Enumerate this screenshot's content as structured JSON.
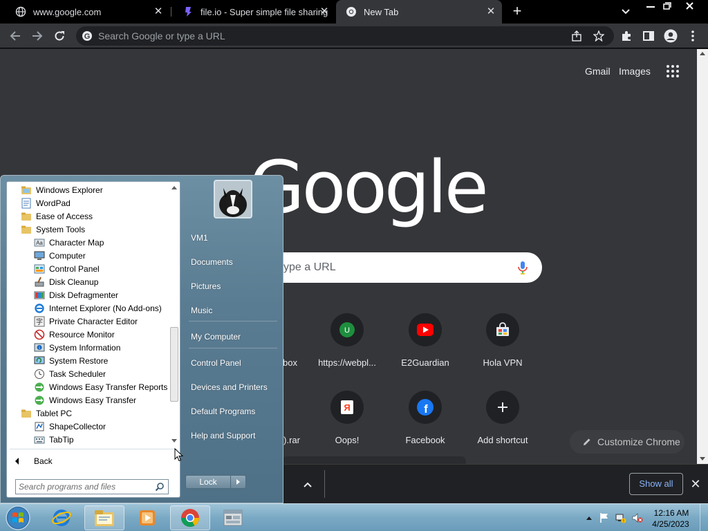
{
  "browser": {
    "tabs": [
      {
        "title": "www.google.com",
        "icon": "globe-icon"
      },
      {
        "title": "file.io - Super simple file sharing",
        "icon": "fileio-icon"
      },
      {
        "title": "New Tab",
        "icon": "chrome-icon"
      }
    ],
    "omnibox_placeholder": "Search Google or type a URL"
  },
  "ntp": {
    "gmail": "Gmail",
    "images": "Images",
    "logo": "Google",
    "search_placeholder": "ype a URL",
    "shortcuts": [
      {
        "label": "box",
        "icon": "hidden-icon"
      },
      {
        "label": "https://webpl...",
        "icon": "letter-u-icon",
        "letter": "U",
        "color": "#1e8e3e"
      },
      {
        "label": "E2Guardian",
        "icon": "youtube-icon",
        "color": "#ff0000"
      },
      {
        "label": "Hola VPN",
        "icon": "store-icon"
      },
      {
        "label": ").rar",
        "icon": "hidden-icon"
      },
      {
        "label": "Oops!",
        "icon": "yandex-icon"
      },
      {
        "label": "Facebook",
        "icon": "facebook-icon",
        "color": "#1877f2"
      },
      {
        "label": "Add shortcut",
        "icon": "plus-icon"
      }
    ],
    "customize": "Customize Chrome"
  },
  "downloads": {
    "show_all": "Show all"
  },
  "start_menu": {
    "programs": [
      {
        "label": "Windows Explorer",
        "icon": "folder-explorer-icon",
        "indent": 1
      },
      {
        "label": "WordPad",
        "icon": "wordpad-icon",
        "indent": 1
      },
      {
        "label": "Ease of Access",
        "icon": "folder-icon",
        "indent": 1
      },
      {
        "label": "System Tools",
        "icon": "folder-icon",
        "indent": 1
      },
      {
        "label": "Character Map",
        "icon": "character-map-icon",
        "indent": 2
      },
      {
        "label": "Computer",
        "icon": "computer-icon",
        "indent": 2
      },
      {
        "label": "Control Panel",
        "icon": "control-panel-icon",
        "indent": 2
      },
      {
        "label": "Disk Cleanup",
        "icon": "disk-cleanup-icon",
        "indent": 2
      },
      {
        "label": "Disk Defragmenter",
        "icon": "defragmenter-icon",
        "indent": 2
      },
      {
        "label": "Internet Explorer (No Add-ons)",
        "icon": "internet-explorer-icon",
        "indent": 2
      },
      {
        "label": "Private Character Editor",
        "icon": "character-editor-icon",
        "indent": 2
      },
      {
        "label": "Resource Monitor",
        "icon": "resource-monitor-icon",
        "indent": 2
      },
      {
        "label": "System Information",
        "icon": "system-information-icon",
        "indent": 2
      },
      {
        "label": "System Restore",
        "icon": "system-restore-icon",
        "indent": 2
      },
      {
        "label": "Task Scheduler",
        "icon": "task-scheduler-icon",
        "indent": 2
      },
      {
        "label": "Windows Easy Transfer Reports",
        "icon": "easy-transfer-icon",
        "indent": 2
      },
      {
        "label": "Windows Easy Transfer",
        "icon": "easy-transfer-icon",
        "indent": 2
      },
      {
        "label": "Tablet PC",
        "icon": "folder-icon",
        "indent": 1
      },
      {
        "label": "ShapeCollector",
        "icon": "shape-collector-icon",
        "indent": 2
      },
      {
        "label": "TabTip",
        "icon": "tabtip-icon",
        "indent": 2
      }
    ],
    "back": "Back",
    "search_placeholder": "Search programs and files",
    "right_links": [
      {
        "label": "VM1"
      },
      {
        "label": "Documents"
      },
      {
        "label": "Pictures"
      },
      {
        "label": "Music"
      },
      {
        "label": "My Computer"
      },
      {
        "label": "Control Panel"
      },
      {
        "label": "Devices and Printers"
      },
      {
        "label": "Default Programs"
      },
      {
        "label": "Help and Support"
      }
    ],
    "lock": "Lock"
  },
  "taskbar": {
    "time": "12:16 AM",
    "date": "4/25/2023"
  }
}
